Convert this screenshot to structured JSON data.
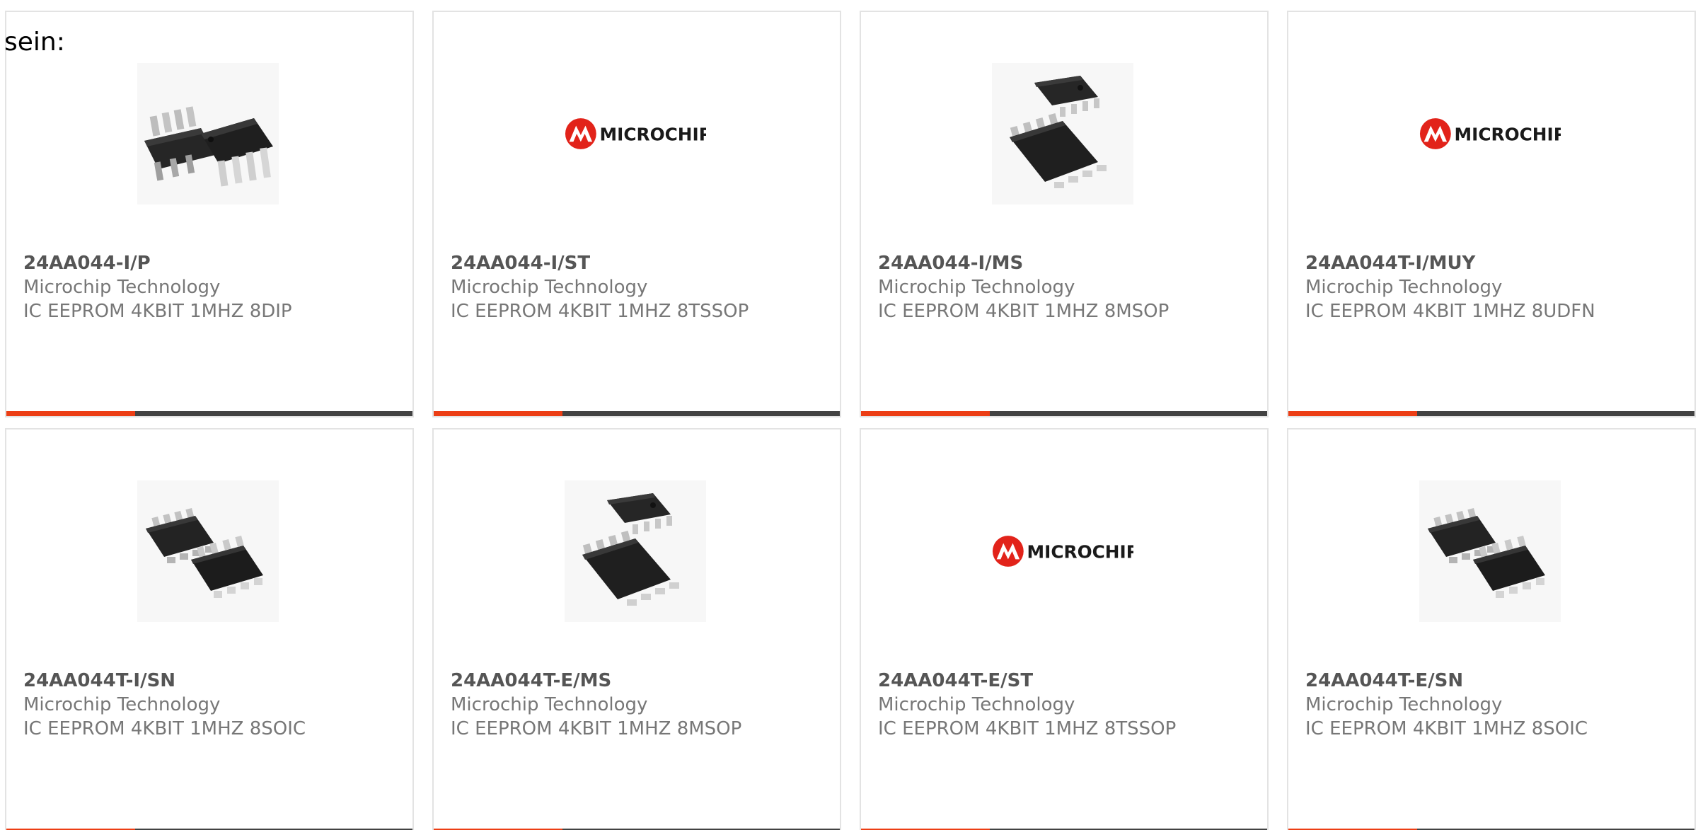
{
  "page": {
    "intro_text": "sein:"
  },
  "colors": {
    "accent": "#ec3e15",
    "bar_dark": "#424242",
    "part_number": "#555555",
    "secondary_text": "#777777",
    "card_border": "#e3e3e3"
  },
  "products": [
    {
      "part_number": "24AA044-I/P",
      "manufacturer": "Microchip Technology",
      "description": "IC EEPROM 4KBIT 1MHZ 8DIP",
      "image": "dip-package-photo"
    },
    {
      "part_number": "24AA044-I/ST",
      "manufacturer": "Microchip Technology",
      "description": "IC EEPROM 4KBIT 1MHZ 8TSSOP",
      "image": "microchip-logo",
      "logo_text": "MICROCHIP"
    },
    {
      "part_number": "24AA044-I/MS",
      "manufacturer": "Microchip Technology",
      "description": "IC EEPROM 4KBIT 1MHZ 8MSOP",
      "image": "msop-package-photo"
    },
    {
      "part_number": "24AA044T-I/MUY",
      "manufacturer": "Microchip Technology",
      "description": "IC EEPROM 4KBIT 1MHZ 8UDFN",
      "image": "microchip-logo",
      "logo_text": "MICROCHIP"
    },
    {
      "part_number": "24AA044T-I/SN",
      "manufacturer": "Microchip Technology",
      "description": "IC EEPROM 4KBIT 1MHZ 8SOIC",
      "image": "soic-package-photo"
    },
    {
      "part_number": "24AA044T-E/MS",
      "manufacturer": "Microchip Technology",
      "description": "IC EEPROM 4KBIT 1MHZ 8MSOP",
      "image": "msop-package-photo"
    },
    {
      "part_number": "24AA044T-E/ST",
      "manufacturer": "Microchip Technology",
      "description": "IC EEPROM 4KBIT 1MHZ 8TSSOP",
      "image": "microchip-logo",
      "logo_text": "MICROCHIP"
    },
    {
      "part_number": "24AA044T-E/SN",
      "manufacturer": "Microchip Technology",
      "description": "IC EEPROM 4KBIT 1MHZ 8SOIC",
      "image": "soic-package-photo"
    }
  ]
}
